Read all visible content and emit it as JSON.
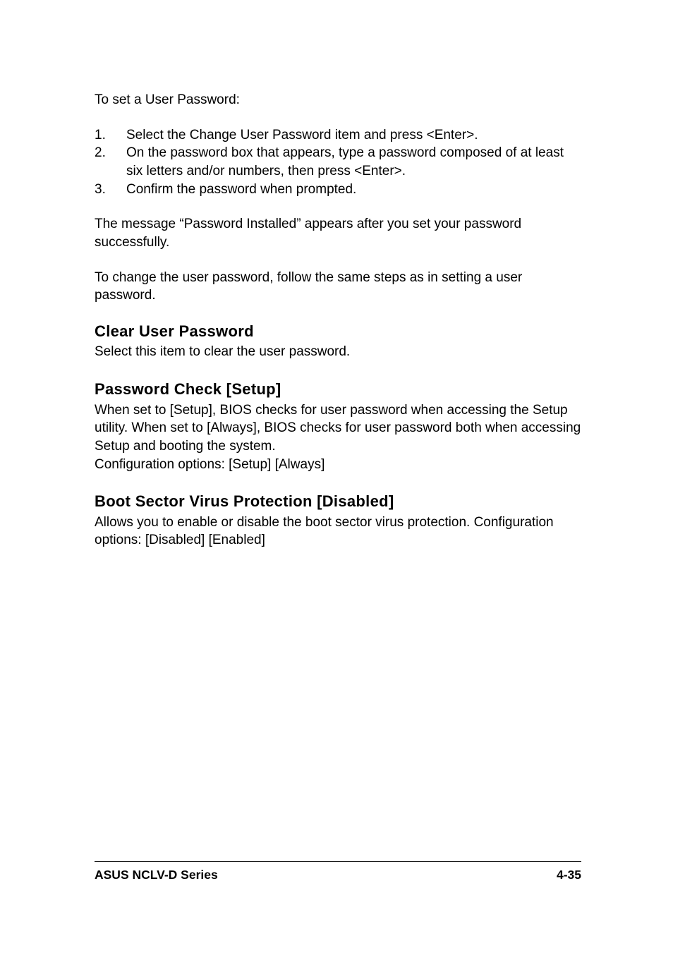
{
  "intro": "To set a User Password:",
  "steps": [
    {
      "num": "1.",
      "text": "Select the Change User Password item and press <Enter>."
    },
    {
      "num": "2.",
      "text": "On the password box that appears, type a password composed of at least six letters and/or numbers, then press <Enter>."
    },
    {
      "num": "3.",
      "text": "Confirm the password when prompted."
    }
  ],
  "para1": "The message “Password Installed” appears after you set your password successfully.",
  "para2": "To change the user password, follow the same steps as in setting a user password.",
  "sections": [
    {
      "heading": "Clear User Password",
      "body": "Select this item to clear the user password."
    },
    {
      "heading": "Password Check [Setup]",
      "body": "When set to [Setup], BIOS checks for user password when accessing the Setup utility. When set to [Always], BIOS checks for user password both when accessing Setup and booting the system.\nConfiguration options: [Setup] [Always]"
    },
    {
      "heading": "Boot Sector Virus Protection [Disabled]",
      "body": "Allows you to enable or disable the boot sector virus protection. Configuration options: [Disabled] [Enabled]"
    }
  ],
  "footer": {
    "left": "ASUS NCLV-D Series",
    "right": "4-35"
  }
}
